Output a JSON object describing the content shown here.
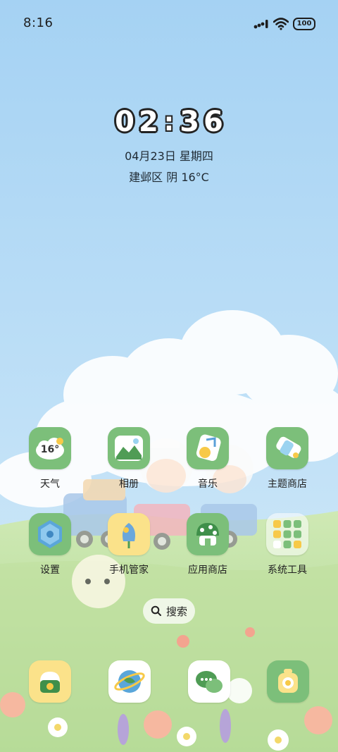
{
  "status_bar": {
    "time": "8:16",
    "battery_level": "100",
    "icons": [
      "signal-icon",
      "wifi-icon",
      "battery-icon"
    ]
  },
  "lockclock": {
    "digits": [
      "0",
      "2",
      "3",
      "6"
    ],
    "separator": ":",
    "date": "04月23日 星期四",
    "weather": "建邺区 阴 16°C"
  },
  "apps": {
    "weather": {
      "label": "天气",
      "temp": "16°",
      "icon": "weather-icon"
    },
    "gallery": {
      "label": "相册",
      "icon": "gallery-icon"
    },
    "music": {
      "label": "音乐",
      "icon": "music-icon"
    },
    "themes": {
      "label": "主题商店",
      "icon": "theme-store-icon"
    },
    "settings": {
      "label": "设置",
      "icon": "settings-icon"
    },
    "security": {
      "label": "手机管家",
      "icon": "security-icon"
    },
    "appstore": {
      "label": "应用商店",
      "icon": "app-store-icon"
    },
    "tools": {
      "label": "系统工具",
      "icon": "folder-icon"
    }
  },
  "search": {
    "label": "搜索",
    "icon": "search-icon"
  },
  "dock": [
    {
      "icon": "phone-icon"
    },
    {
      "icon": "browser-icon"
    },
    {
      "icon": "messages-icon"
    },
    {
      "icon": "camera-icon"
    }
  ],
  "colors": {
    "sky_top": "#a8d4f4",
    "sky_mid": "#c4e3f8",
    "grass": "#c6e4a6",
    "icon_green": "#7cbf7a",
    "icon_yellow": "#fbe28a",
    "icon_white": "#ffffff"
  }
}
